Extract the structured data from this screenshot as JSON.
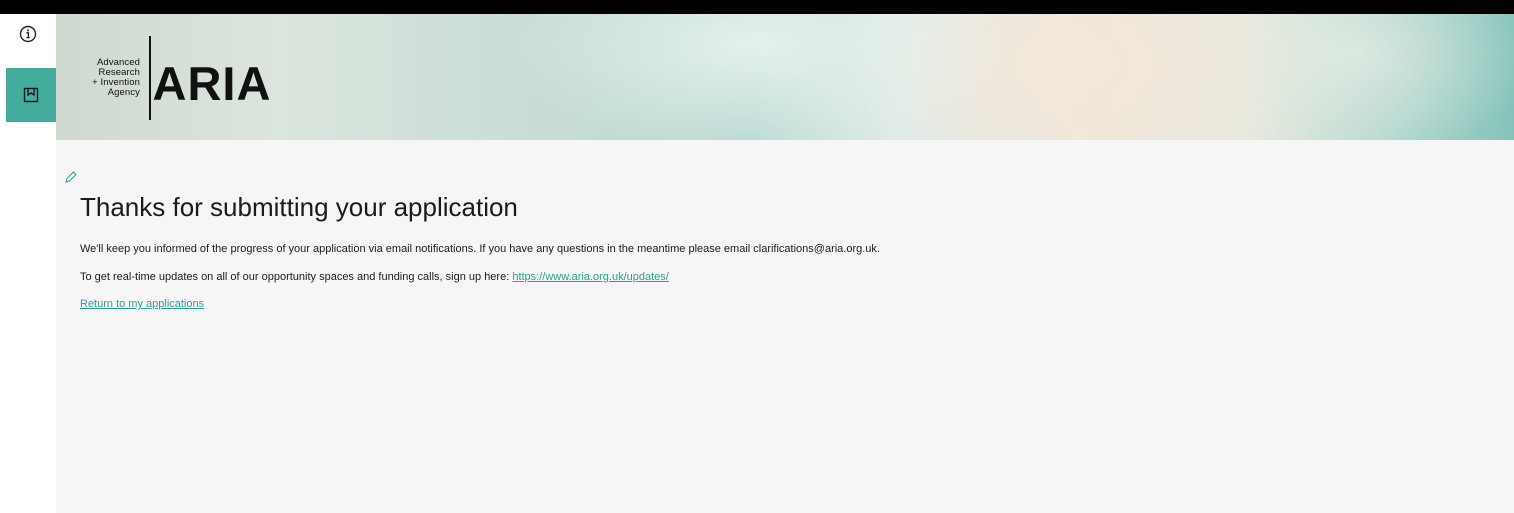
{
  "sidebar": {
    "items": [
      {
        "icon": "info-icon"
      },
      {
        "icon": "bookmark-icon",
        "active": true
      }
    ]
  },
  "header": {
    "logo_small": [
      "Advanced",
      "Research",
      "+ Invention",
      "Agency"
    ],
    "logo_big": "ARIA"
  },
  "main": {
    "edit_icon": "edit-pencil-icon",
    "title": "Thanks for submitting your application",
    "paragraph1": "We'll keep you informed of the progress of your application via email notifications. If you have any questions in the meantime please email clarifications@aria.org.uk.",
    "paragraph2_prefix": "To get real-time updates on all of our opportunity spaces and funding calls, sign up here: ",
    "paragraph2_link": "https://www.aria.org.uk/updates/",
    "return_link": "Return to my applications"
  },
  "colors": {
    "accent": "#45ab9c",
    "link": "#2d9f93",
    "top_bar": "#000000",
    "main_bg": "#f6f6f6"
  }
}
